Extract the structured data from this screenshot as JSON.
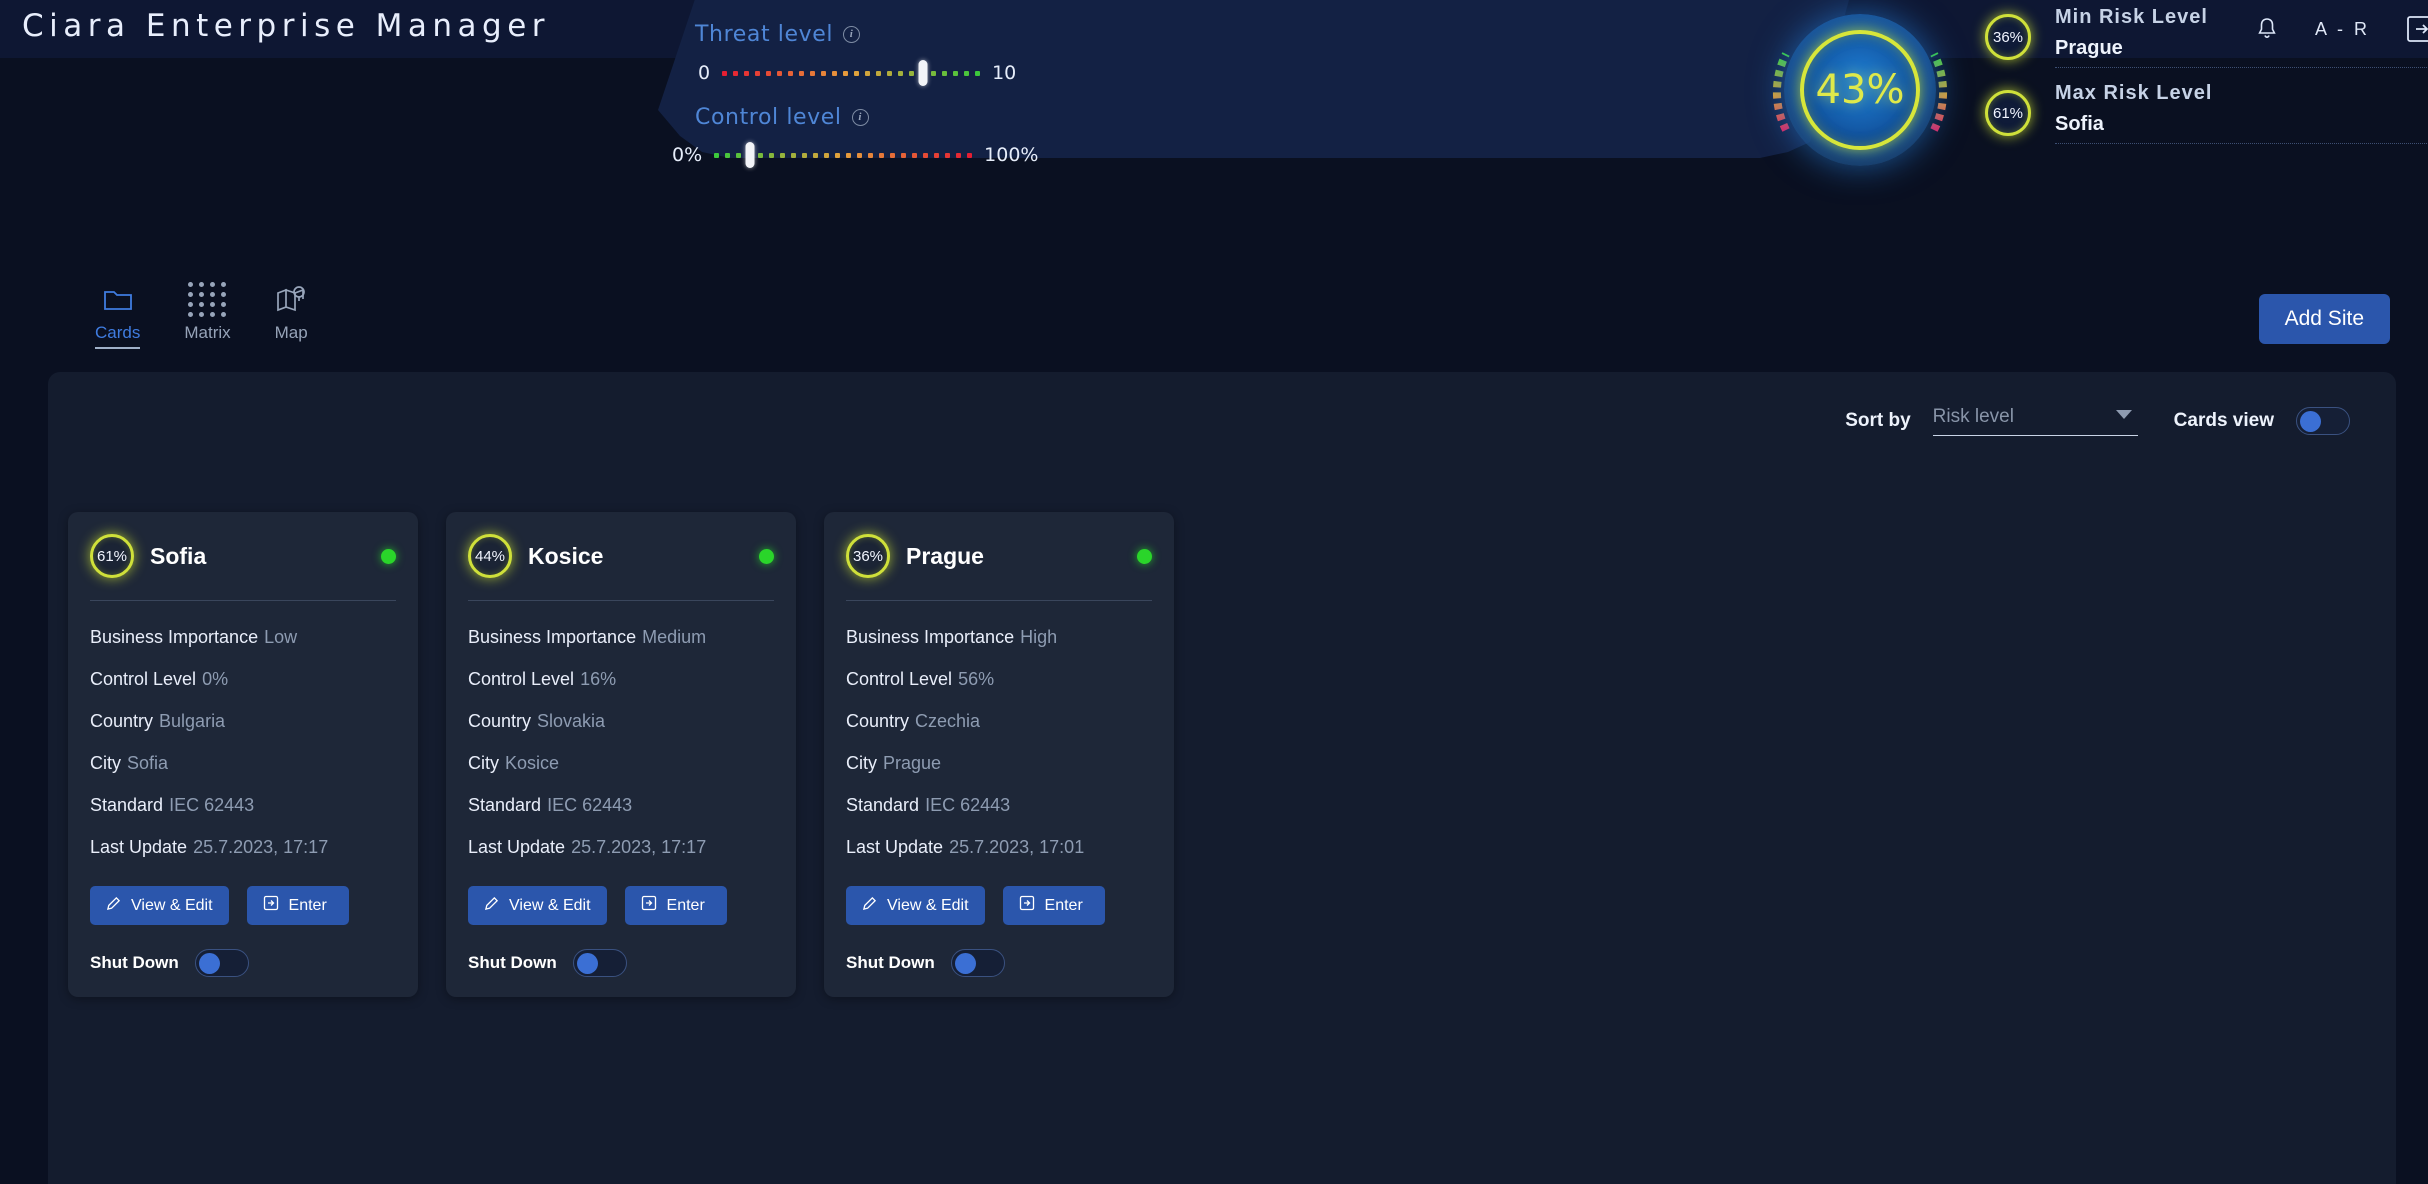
{
  "app": {
    "title": "Ciara Enterprise Manager",
    "user_initials": "A - R",
    "bell_icon": "bell-icon",
    "logout_icon": "logout-icon"
  },
  "hero": {
    "threat": {
      "label": "Threat level",
      "info_icon": "info-icon",
      "min": "0",
      "max": "10",
      "value_pct": 78
    },
    "control": {
      "label": "Control level",
      "info_icon": "info-icon",
      "min": "0%",
      "max": "100%",
      "value_pct": 14
    },
    "gauge": {
      "value": "43%",
      "ring_color": "#d7e63a"
    },
    "risks": [
      {
        "badge": "36%",
        "title": "Min Risk Level",
        "value": "Prague"
      },
      {
        "badge": "61%",
        "title": "Max Risk Level",
        "value": "Sofia"
      }
    ]
  },
  "tabs": [
    {
      "label": "Cards",
      "icon": "cards-icon",
      "active": true
    },
    {
      "label": "Matrix",
      "icon": "matrix-icon",
      "active": false
    },
    {
      "label": "Map",
      "icon": "map-pin-icon",
      "active": false
    }
  ],
  "actions": {
    "add_site": "Add Site"
  },
  "controls": {
    "sort_label": "Sort by",
    "sort_value": "Risk level",
    "cards_view_label": "Cards view",
    "cards_view_on": true
  },
  "card_fields": {
    "business_importance": "Business Importance",
    "control_level": "Control Level",
    "country": "Country",
    "city": "City",
    "standard": "Standard",
    "last_update": "Last Update",
    "view_edit": "View & Edit",
    "enter": "Enter",
    "shut_down": "Shut Down"
  },
  "cards": [
    {
      "risk": "61%",
      "name": "Sofia",
      "status": "online",
      "business_importance": "Low",
      "control_level": "0%",
      "country": "Bulgaria",
      "city": "Sofia",
      "standard": "IEC 62443",
      "last_update": "25.7.2023, 17:17"
    },
    {
      "risk": "44%",
      "name": "Kosice",
      "status": "online",
      "business_importance": "Medium",
      "control_level": "16%",
      "country": "Slovakia",
      "city": "Kosice",
      "standard": "IEC 62443",
      "last_update": "25.7.2023, 17:17"
    },
    {
      "risk": "36%",
      "name": "Prague",
      "status": "online",
      "business_importance": "High",
      "control_level": "56%",
      "country": "Czechia",
      "city": "Prague",
      "standard": "IEC 62443",
      "last_update": "25.7.2023, 17:01"
    }
  ],
  "colors": {
    "accent_blue": "#2b56ac",
    "risk_yellow": "#cfe03a",
    "status_green": "#2ad52a",
    "panel_bg": "#141c2e",
    "card_bg": "#1e2738"
  }
}
